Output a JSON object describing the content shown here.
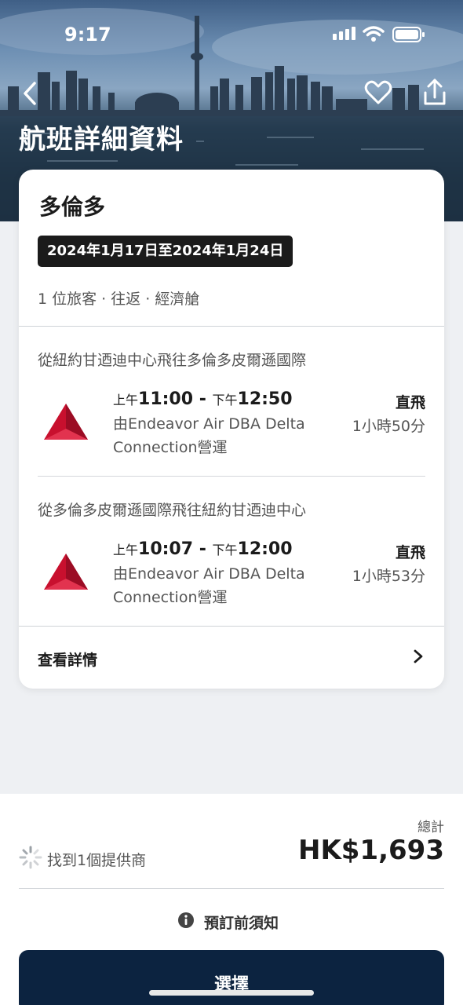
{
  "status": {
    "time": "9:17"
  },
  "header": {
    "title": "航班詳細資料"
  },
  "trip": {
    "destination": "多倫多",
    "dates": "2024年1月17日至2024年1月24日",
    "meta": "1 位旅客 · 往返 · 經濟艙"
  },
  "flights": [
    {
      "route": "從紐約甘迺迪中心飛往多倫多皮爾遜國際",
      "dep_prefix": "上午",
      "dep_time": "11:00",
      "sep": " - ",
      "arr_prefix": "下午",
      "arr_time": "12:50",
      "operator": "由Endeavor Air DBA Delta Connection營運",
      "stops": "直飛",
      "duration": "1小時50分"
    },
    {
      "route": "從多倫多皮爾遜國際飛往紐約甘迺迪中心",
      "dep_prefix": "上午",
      "dep_time": "10:07",
      "sep": " - ",
      "arr_prefix": "下午",
      "arr_time": "12:00",
      "operator": "由Endeavor Air DBA Delta Connection營運",
      "stops": "直飛",
      "duration": "1小時53分"
    }
  ],
  "details": {
    "label": "查看詳情"
  },
  "summary": {
    "total_label": "總計",
    "price": "HK$1,693",
    "providers": "找到1個提供商",
    "info": "預訂前須知",
    "select": "選擇"
  },
  "colors": {
    "brand_navy": "#0c2340",
    "delta_red": "#c8102e"
  },
  "icons": [
    "back-icon",
    "heart-icon",
    "share-icon",
    "delta-logo",
    "chevron-right-icon",
    "spinner-icon",
    "info-icon"
  ]
}
